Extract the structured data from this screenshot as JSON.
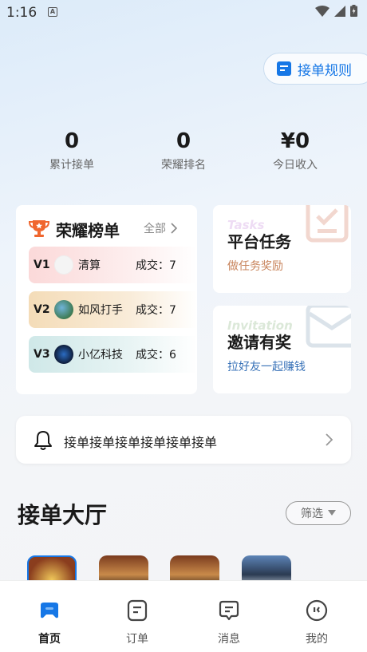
{
  "status_bar": {
    "time": "1:16",
    "notification_letter": "A"
  },
  "rules_button": {
    "label": "接单规则"
  },
  "stats": [
    {
      "value": "0",
      "label": "累计接单"
    },
    {
      "value": "0",
      "label": "荣耀排名"
    },
    {
      "value": "¥0",
      "label": "今日收入"
    }
  ],
  "ranking": {
    "title": "荣耀榜单",
    "all_label": "全部",
    "rows": [
      {
        "level": "V1",
        "name": "清算",
        "deal": "成交：7"
      },
      {
        "level": "V2",
        "name": "如风打手",
        "deal": "成交：7"
      },
      {
        "level": "V3",
        "name": "小亿科技",
        "deal": "成交：6"
      }
    ]
  },
  "platform_task": {
    "title": "平台任务",
    "subtitle": "做任务奖励",
    "script": "Tasks",
    "accent": "#c8845c"
  },
  "invite": {
    "title": "邀请有奖",
    "subtitle": "拉好友一起赚钱",
    "script": "Invitation",
    "accent": "#3a73b8"
  },
  "notice": {
    "text": "接单接单接单接单接单接单"
  },
  "hall": {
    "title": "接单大厅",
    "filter_label": "筛选"
  },
  "tabbar": {
    "tabs": [
      {
        "label": "首页",
        "icon": "gamepad-icon",
        "active": true
      },
      {
        "label": "订单",
        "icon": "order-icon",
        "active": false
      },
      {
        "label": "消息",
        "icon": "message-icon",
        "active": false
      },
      {
        "label": "我的",
        "icon": "profile-icon",
        "active": false
      }
    ]
  },
  "colors": {
    "brand": "#1677e6",
    "tab_active": "#1677e6"
  }
}
